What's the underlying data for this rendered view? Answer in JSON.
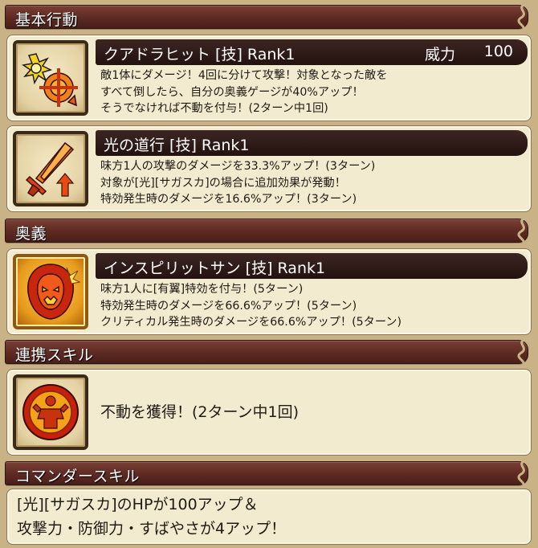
{
  "sections": {
    "basic_action": "基本行動",
    "ougi": "奥義",
    "link_skill": "連携スキル",
    "commander_skill": "コマンダースキル"
  },
  "skills": [
    {
      "name": "クアドラヒット [技]  Rank1",
      "power_label": "威力",
      "power_value": "100",
      "icon": "quad-hit-icon",
      "lines": [
        "敵1体にダメージ！4回に分けて攻撃！対象となった敵を",
        "すべて倒したら、自分の奥義ゲージが40%アップ！",
        "そうでなければ不動を付与！(2ターン中1回)"
      ]
    },
    {
      "name": "光の道行 [技]  Rank1",
      "icon": "sword-buff-icon",
      "lines": [
        "味方1人の攻撃のダメージを33.3%アップ！(3ターン)",
        "対象が[光][サガスカ]の場合に追加効果が発動！",
        "特効発生時のダメージを16.6%アップ！(3ターン)"
      ]
    },
    {
      "name": "インスピリットサン [技]  Rank1",
      "icon": "inspirit-sun-icon",
      "lines": [
        "味方1人に[有翼]特効を付与！(5ターン)",
        "特効発生時のダメージを66.6%アップ！(5ターン)",
        "クリティカル発生時のダメージを66.6%アップ！(5ターン)"
      ]
    }
  ],
  "link_skill": {
    "icon": "immovable-icon",
    "text": "不動を獲得！(2ターン中1回)"
  },
  "commander_skill": {
    "lines": [
      "[光][サガスカ]のHPが100アップ＆",
      "攻撃力・防御力・すばやさが4アップ！"
    ]
  },
  "colors": {
    "background": "#c9b286",
    "header": "#5c2a22",
    "card": "#f3ebcf",
    "name_bar": "#23120f",
    "accent": "#e8561c"
  }
}
